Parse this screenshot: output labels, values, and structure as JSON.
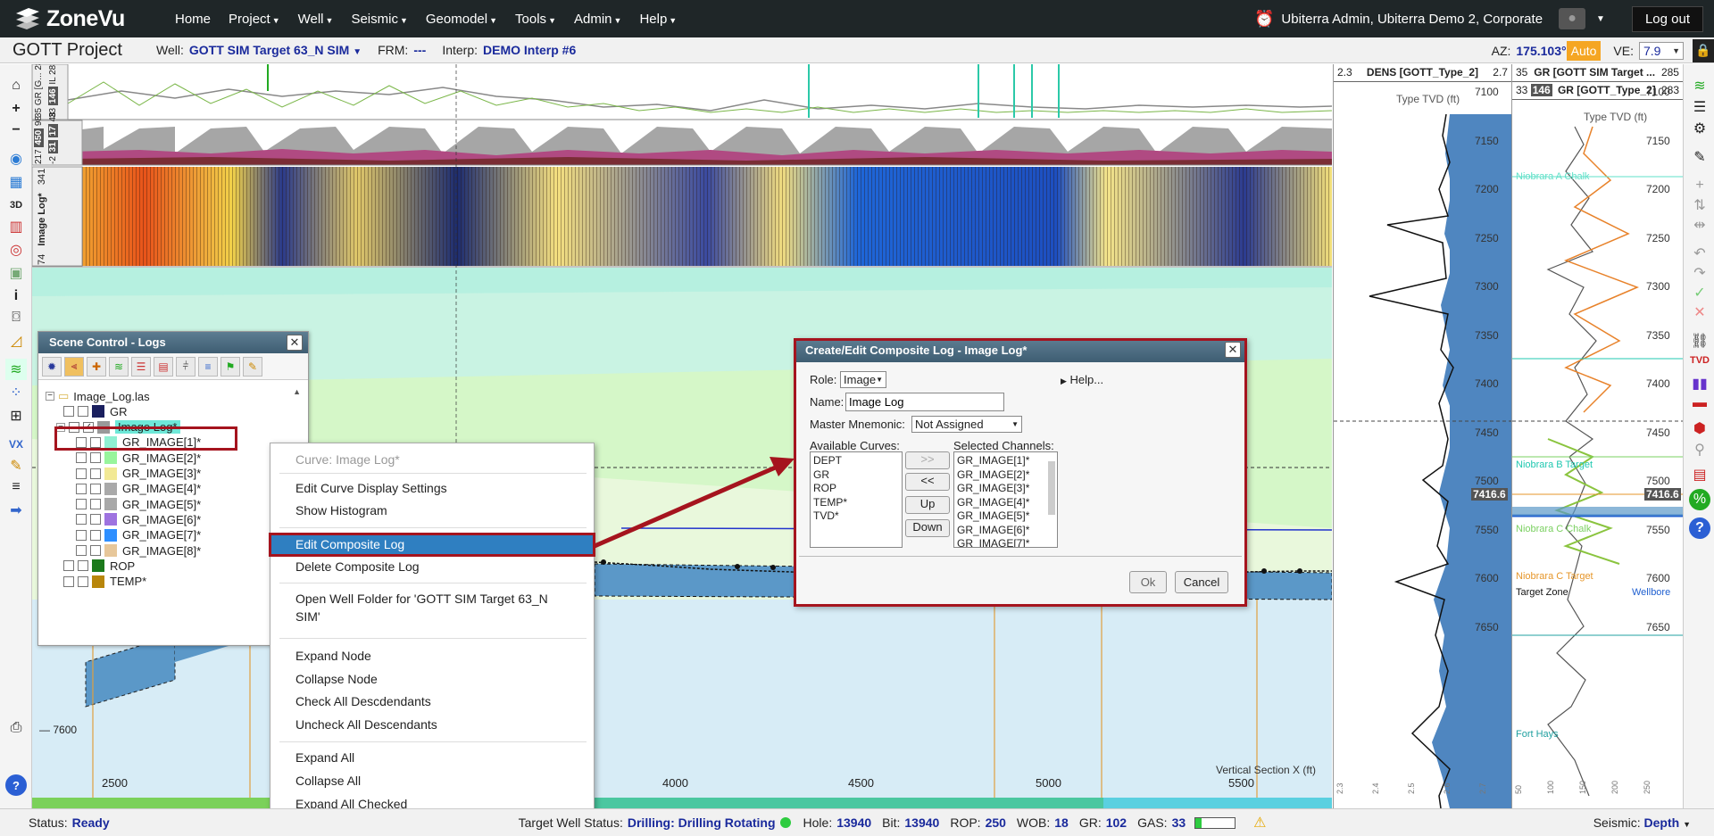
{
  "nav": {
    "logo_text": "ZoneVu",
    "menu": [
      {
        "label": "Home",
        "caret": false
      },
      {
        "label": "Project",
        "caret": true
      },
      {
        "label": "Well",
        "caret": true
      },
      {
        "label": "Seismic",
        "caret": true
      },
      {
        "label": "Geomodel",
        "caret": true
      },
      {
        "label": "Tools",
        "caret": true
      },
      {
        "label": "Admin",
        "caret": true
      },
      {
        "label": "Help",
        "caret": true
      }
    ],
    "user": "Ubiterra Admin, Ubiterra Demo 2, Corporate",
    "logout": "Log out"
  },
  "project": {
    "title": "GOTT Project",
    "well_label": "Well:",
    "well": "GOTT SIM Target 63_N SIM",
    "frm_label": "FRM:",
    "frm": "---",
    "interp_label": "Interp:",
    "interp": "DEMO Interp #6",
    "az_label": "AZ:",
    "az": "175.103°",
    "auto": "Auto",
    "ve_label": "VE:",
    "ve": "7.9"
  },
  "tracks": {
    "t1_labels": [
      "35",
      "GR [G...",
      "285",
      "33",
      "146",
      "IL",
      "283"
    ],
    "t2_labels": [
      "217",
      "450",
      "98",
      "-2",
      "31",
      "17",
      "48"
    ],
    "t3_labels": [
      "74",
      "Image Log*",
      "341"
    ],
    "depth_label": "7600",
    "xaxis_title": "Vertical Section X (ft)",
    "xticks": [
      "2500",
      "4000",
      "4500",
      "5000",
      "5500"
    ],
    "section_label": "Vertical Section X (ft)"
  },
  "right_logs": {
    "dens": {
      "left": "2.3",
      "name": "DENS [GOTT_Type_2]",
      "right": "2.7",
      "sub": "Type TVD (ft)"
    },
    "gr": {
      "left": "35",
      "name": "GR [GOTT SIM Target ...",
      "right": "285",
      "left2": "33",
      "mid2": "146",
      "name2": "GR [GOTT_Type_2]",
      "right2": "283",
      "sub": "Type TVD (ft)"
    },
    "depths": [
      "7100",
      "7150",
      "7200",
      "7250",
      "7300",
      "7350",
      "7400",
      "7450",
      "7500",
      "7550",
      "7600",
      "7650"
    ],
    "cursor_depth": "7416.6",
    "formations": [
      "Niobrara A Chalk",
      "Niobrara B Target",
      "Niobrara C Chalk",
      "Niobrara C Target",
      "Target Zone",
      "Fort Hays"
    ],
    "wellbore": "Wellbore",
    "bottom_ticks_dens": [
      "2.3",
      "2.4",
      "2.5",
      "2.6",
      "2.7"
    ],
    "bottom_ticks_gr": [
      "50",
      "100",
      "150",
      "200",
      "250"
    ]
  },
  "scene": {
    "title": "Scene Control - Logs",
    "tree": [
      {
        "label": "Image_Log.las",
        "type": "folder"
      },
      {
        "label": "GR",
        "color": "#1a1f5e"
      },
      {
        "label": "Image Log*",
        "color": "#999999",
        "checked": true,
        "selected": true
      },
      {
        "label": "GR_IMAGE[1]*",
        "color": "#8ff0d2"
      },
      {
        "label": "GR_IMAGE[2]*",
        "color": "#98f59c"
      },
      {
        "label": "GR_IMAGE[3]*",
        "color": "#f2e995"
      },
      {
        "label": "GR_IMAGE[4]*",
        "color": "#a9a9a9"
      },
      {
        "label": "GR_IMAGE[5]*",
        "color": "#a8a8a8"
      },
      {
        "label": "GR_IMAGE[6]*",
        "color": "#9e73e0"
      },
      {
        "label": "GR_IMAGE[7]*",
        "color": "#2f8fff"
      },
      {
        "label": "GR_IMAGE[8]*",
        "color": "#e7c79a"
      },
      {
        "label": "ROP",
        "color": "#1c7a1c"
      },
      {
        "label": "TEMP*",
        "color": "#b8860b"
      }
    ]
  },
  "context_menu": {
    "header": "Curve: Image Log*",
    "items": [
      "Edit Curve Display Settings",
      "Show Histogram",
      "Edit Composite Log",
      "Delete Composite Log",
      "Open Well Folder for 'GOTT SIM Target 63_N SIM'",
      "Expand Node",
      "Collapse Node",
      "Check All Descdendants",
      "Uncheck All Descendants",
      "Expand All",
      "Collapse All",
      "Expand All Checked"
    ]
  },
  "dialog": {
    "title": "Create/Edit Composite Log - Image Log*",
    "role_label": "Role:",
    "role": "Image",
    "help": "Help...",
    "name_label": "Name:",
    "name": "Image Log",
    "master_label": "Master Mnemonic:",
    "master": "Not Assigned",
    "available_label": "Available Curves:",
    "available": [
      "DEPT",
      "GR",
      "ROP",
      "TEMP*",
      "TVD*"
    ],
    "selected_label": "Selected Channels:",
    "selected": [
      "GR_IMAGE[1]*",
      "GR_IMAGE[2]*",
      "GR_IMAGE[3]*",
      "GR_IMAGE[4]*",
      "GR_IMAGE[5]*",
      "GR_IMAGE[6]*",
      "GR_IMAGE[7]*"
    ],
    "btn_add": ">>",
    "btn_remove": "<<",
    "btn_up": "Up",
    "btn_down": "Down",
    "ok": "Ok",
    "cancel": "Cancel"
  },
  "status": {
    "status_label": "Status:",
    "status": "Ready",
    "target_label": "Target Well Status:",
    "target": "Drilling: Drilling Rotating",
    "hole_label": "Hole:",
    "hole": "13940",
    "bit_label": "Bit:",
    "bit": "13940",
    "rop_label": "ROP:",
    "rop": "250",
    "wob_label": "WOB:",
    "wob": "18",
    "gr_label": "GR:",
    "gr": "102",
    "gas_label": "GAS:",
    "gas": "33",
    "gas_fill": 0.15,
    "seismic_label": "Seismic:",
    "seismic": "Depth"
  },
  "colors": {
    "accent": "#1a2a9c",
    "highlight": "#a5141e",
    "menu_sel": "#2f7fc1",
    "title_bar": "#4e6e83"
  }
}
